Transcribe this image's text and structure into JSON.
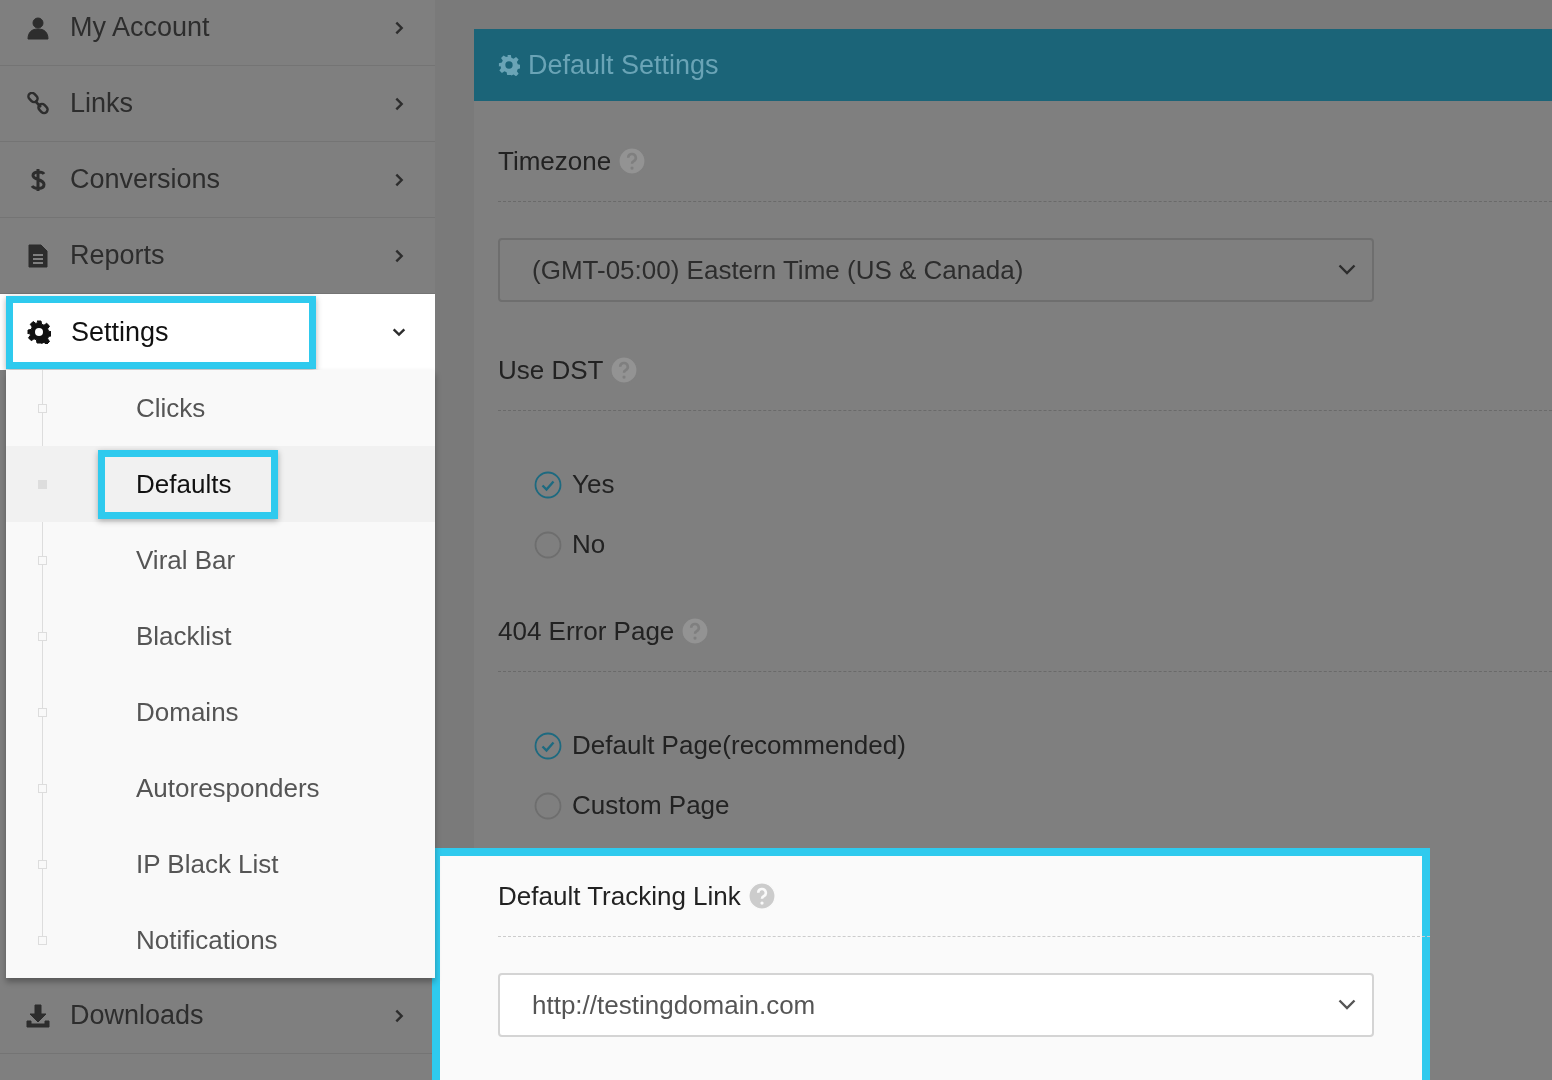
{
  "sidebar": {
    "items": [
      {
        "label": "My Account",
        "expanded": false,
        "highlighted": false
      },
      {
        "label": "Links",
        "expanded": false,
        "highlighted": false
      },
      {
        "label": "Conversions",
        "expanded": false,
        "highlighted": false
      },
      {
        "label": "Reports",
        "expanded": false,
        "highlighted": false
      },
      {
        "label": "Settings",
        "expanded": true,
        "highlighted": true,
        "children": [
          {
            "label": "Clicks",
            "selected": false,
            "highlighted": false
          },
          {
            "label": "Defaults",
            "selected": true,
            "highlighted": true
          },
          {
            "label": "Viral Bar",
            "selected": false,
            "highlighted": false
          },
          {
            "label": "Blacklist",
            "selected": false,
            "highlighted": false
          },
          {
            "label": "Domains",
            "selected": false,
            "highlighted": false
          },
          {
            "label": "Autoresponders",
            "selected": false,
            "highlighted": false
          },
          {
            "label": "IP Black List",
            "selected": false,
            "highlighted": false
          },
          {
            "label": "Notifications",
            "selected": false,
            "highlighted": false
          }
        ]
      },
      {
        "label": "Downloads",
        "expanded": false,
        "highlighted": false
      }
    ]
  },
  "panel": {
    "title": "Default Settings",
    "sections": [
      {
        "kind": "select",
        "label": "Timezone",
        "value": "(GMT-05:00) Eastern Time (US & Canada)",
        "highlighted": false
      },
      {
        "kind": "radio",
        "label": "Use DST",
        "highlighted": false,
        "options": [
          {
            "label": "Yes",
            "selected": true
          },
          {
            "label": "No",
            "selected": false
          }
        ]
      },
      {
        "kind": "radio",
        "label": "404 Error Page",
        "highlighted": false,
        "options": [
          {
            "label": "Default Page(recommended)",
            "selected": true
          },
          {
            "label": "Custom Page",
            "selected": false
          }
        ]
      },
      {
        "kind": "select",
        "label": "Default Tracking Link",
        "value": "http://testingdomain.com",
        "highlighted": true
      }
    ]
  }
}
